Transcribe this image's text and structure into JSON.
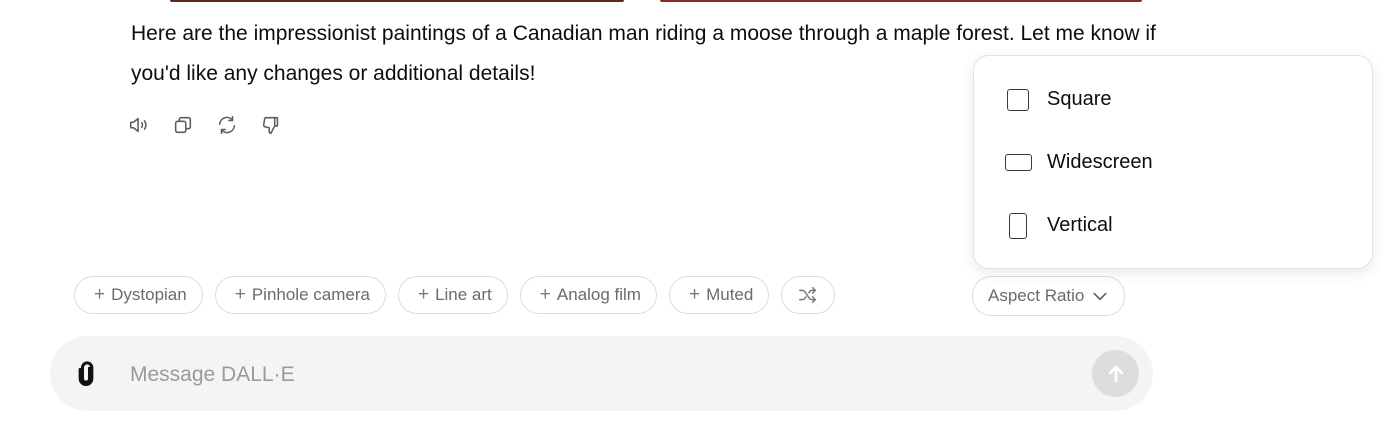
{
  "message": {
    "text": "Here are the impressionist paintings of a Canadian man riding a moose through a maple forest. Let me know if you'd like any changes or additional details!"
  },
  "actions": [
    {
      "name": "read-aloud",
      "icon": "speaker-icon"
    },
    {
      "name": "copy",
      "icon": "copy-icon"
    },
    {
      "name": "regenerate",
      "icon": "refresh-icon"
    },
    {
      "name": "bad-response",
      "icon": "thumbs-down-icon"
    }
  ],
  "style_chips": [
    "Dystopian",
    "Pinhole camera",
    "Line art",
    "Analog film",
    "Muted"
  ],
  "chip_plus": "+",
  "shuffle_icon": "shuffle-icon",
  "aspect_ratio": {
    "label": "Aspect Ratio",
    "options": [
      "Square",
      "Widescreen",
      "Vertical"
    ]
  },
  "composer": {
    "placeholder": "Message DALL·E",
    "attach_icon": "paperclip-icon",
    "send_icon": "arrow-up-icon"
  },
  "colors": {
    "composer_bg": "#f4f4f4",
    "send_disabled": "#dddddd",
    "chip_border": "#dcdcdc"
  }
}
